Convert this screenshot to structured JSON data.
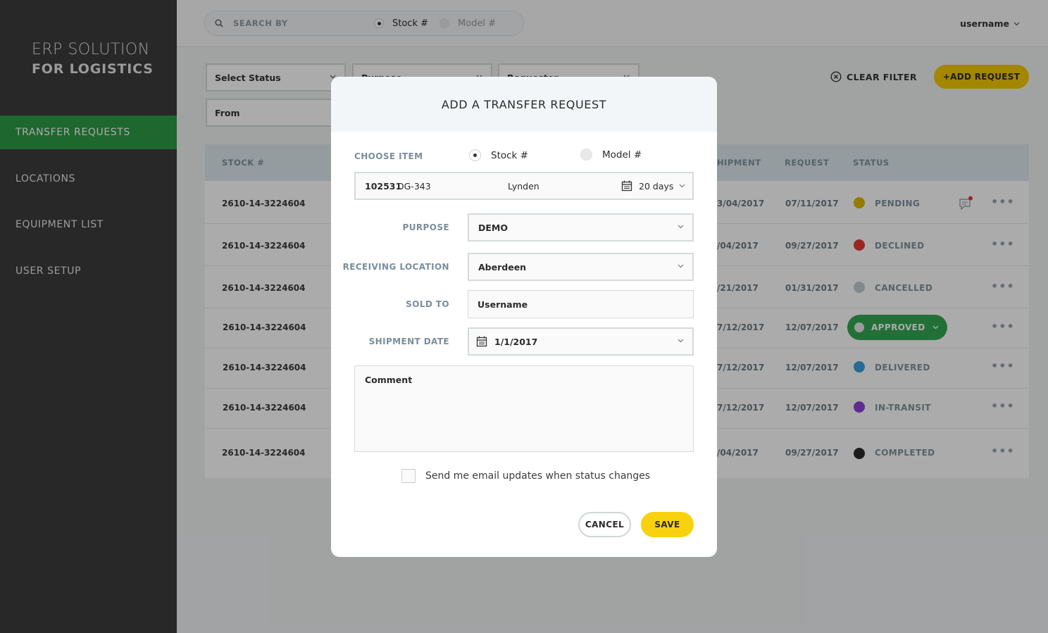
{
  "brand": {
    "line1": "ERP SOLUTION",
    "line2": "FOR LOGISTICS"
  },
  "sidebar": {
    "items": [
      {
        "label": "TRANSFER REQUESTS",
        "active": true
      },
      {
        "label": "LOCATIONS",
        "active": false
      },
      {
        "label": "EQUIPMENT LIST",
        "active": false
      },
      {
        "label": "USER SETUP",
        "active": false
      }
    ]
  },
  "topbar": {
    "search_placeholder": "SEARCH BY",
    "option_stock": "Stock #",
    "option_model": "Model #",
    "username": "username"
  },
  "filters": {
    "status": "Select Status",
    "purpose": "Purpose",
    "requester": "Requester",
    "from": "From",
    "clear_filter": "CLEAR FILTER",
    "add_request": "+ADD REQUEST"
  },
  "table": {
    "headers": {
      "stock": "STOCK #",
      "shipment": "HIPMENT",
      "request": "REQUEST",
      "status": "STATUS"
    },
    "rows": [
      {
        "stock": "2610-14-3224604",
        "shipment": "3/04/2017",
        "request": "07/11/2017",
        "status": "PENDING",
        "color": "#e0b800"
      },
      {
        "stock": "2610-14-3224604",
        "shipment": "/04/2017",
        "request": "09/27/2017",
        "status": "DECLINED",
        "color": "#e53935"
      },
      {
        "stock": "2610-14-3224604",
        "shipment": "/21/2017",
        "request": "01/31/2017",
        "status": "CANCELLED",
        "color": "#c4cbcf"
      },
      {
        "stock": "2610-14-3224604",
        "shipment": "7/12/2017",
        "request": "12/07/2017",
        "status": "APPROVED",
        "color": "#34a853"
      },
      {
        "stock": "2610-14-3224604",
        "shipment": "7/12/2017",
        "request": "12/07/2017",
        "status": "DELIVERED",
        "color": "#3aa0e0"
      },
      {
        "stock": "2610-14-3224604",
        "shipment": "7/12/2017",
        "request": "12/07/2017",
        "status": "IN-TRANSIT",
        "color": "#8e44d8"
      },
      {
        "stock": "2610-14-3224604",
        "shipment": "/04/2017",
        "request": "09/27/2017",
        "status": "COMPLETED",
        "color": "#2b2b2b"
      }
    ]
  },
  "modal": {
    "title": "ADD A TRANSFER REQUEST",
    "choose_item_label": "CHOOSE ITEM",
    "option_stock": "Stock #",
    "option_model": "Model #",
    "item": {
      "stock_no": "102531",
      "model": "DG-343",
      "location": "Lynden",
      "duration": "20 days"
    },
    "purpose_label": "PURPOSE",
    "purpose_value": "DEMO",
    "receiving_label": "RECEIVING LOCATION",
    "receiving_value": "Aberdeen",
    "sold_to_label": "SOLD TO",
    "sold_to_value": "Username",
    "shipment_label": "SHIPMENT DATE",
    "shipment_value": "1/1/2017",
    "comment_placeholder": "Comment",
    "email_updates": "Send me email updates when status changes",
    "cancel": "CANCEL",
    "save": "SAVE"
  }
}
